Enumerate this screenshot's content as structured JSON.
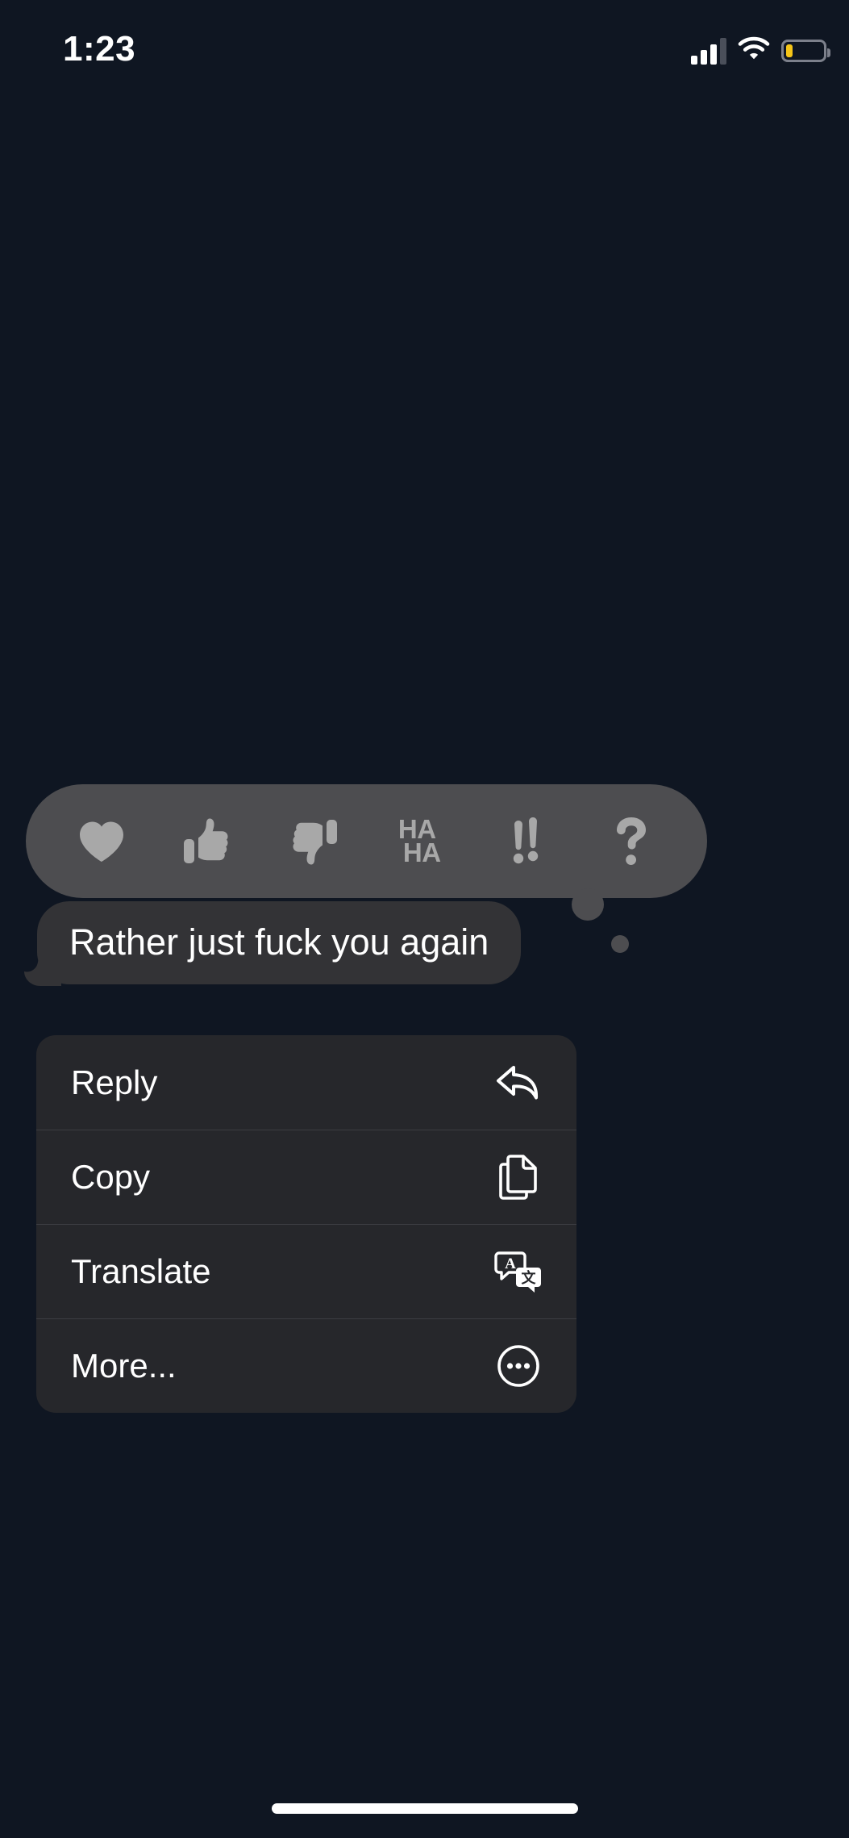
{
  "theme": {
    "background": "#0f1622",
    "bubble_incoming": "#333336",
    "tapback_bar": "#4d4d50",
    "menu_background": "#26272b",
    "menu_divider": "#3c3d42",
    "text_primary": "#ffffff",
    "tapback_glyph": "#a8a8a8",
    "battery_low": "#f5c518",
    "cellular_inactive": "#4a4f5a"
  },
  "status_bar": {
    "time": "1:23",
    "cellular": {
      "icon": "cellular-bars-icon",
      "bars_total": 4,
      "bars_active": 3
    },
    "wifi": {
      "icon": "wifi-icon",
      "strength": "full"
    },
    "battery": {
      "icon": "battery-icon",
      "level_percent": 15,
      "low_power_mode": true
    }
  },
  "tapback": {
    "name": "tapback-reaction-bar",
    "options": [
      {
        "id": "heart",
        "icon": "heart-icon",
        "label": "Love"
      },
      {
        "id": "thumbsup",
        "icon": "thumbs-up-icon",
        "label": "Like"
      },
      {
        "id": "thumbsdown",
        "icon": "thumbs-down-icon",
        "label": "Dislike"
      },
      {
        "id": "haha",
        "icon": "haha-icon",
        "label": "Haha",
        "line1": "HA",
        "line2": "HA"
      },
      {
        "id": "exclamation",
        "icon": "double-exclamation-icon",
        "label": "Exclamation",
        "glyph": "‼"
      },
      {
        "id": "question",
        "icon": "question-mark-icon",
        "label": "Question",
        "glyph": "?"
      }
    ]
  },
  "message": {
    "text": "Rather just fuck you again",
    "direction": "incoming"
  },
  "context_menu": {
    "items": [
      {
        "label": "Reply",
        "icon": "reply-arrow-icon"
      },
      {
        "label": "Copy",
        "icon": "copy-documents-icon"
      },
      {
        "label": "Translate",
        "icon": "translate-bubbles-icon"
      },
      {
        "label": "More...",
        "icon": "more-ellipsis-circle-icon"
      }
    ]
  },
  "home_indicator": {
    "label": "home-indicator"
  }
}
